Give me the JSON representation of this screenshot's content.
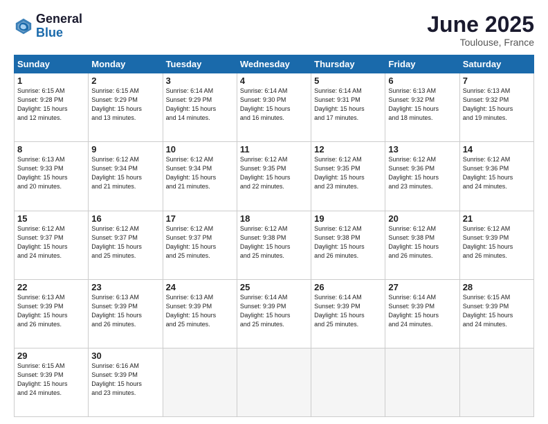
{
  "header": {
    "logo_line1": "General",
    "logo_line2": "Blue",
    "month": "June 2025",
    "location": "Toulouse, France"
  },
  "weekdays": [
    "Sunday",
    "Monday",
    "Tuesday",
    "Wednesday",
    "Thursday",
    "Friday",
    "Saturday"
  ],
  "days": [
    {
      "num": "",
      "info": ""
    },
    {
      "num": "",
      "info": ""
    },
    {
      "num": "",
      "info": ""
    },
    {
      "num": "",
      "info": ""
    },
    {
      "num": "",
      "info": ""
    },
    {
      "num": "",
      "info": ""
    },
    {
      "num": "7",
      "info": "Sunrise: 6:13 AM\nSunset: 9:32 PM\nDaylight: 15 hours\nand 19 minutes."
    },
    {
      "num": "1",
      "info": "Sunrise: 6:15 AM\nSunset: 9:28 PM\nDaylight: 15 hours\nand 12 minutes."
    },
    {
      "num": "2",
      "info": "Sunrise: 6:15 AM\nSunset: 9:29 PM\nDaylight: 15 hours\nand 13 minutes."
    },
    {
      "num": "3",
      "info": "Sunrise: 6:14 AM\nSunset: 9:29 PM\nDaylight: 15 hours\nand 14 minutes."
    },
    {
      "num": "4",
      "info": "Sunrise: 6:14 AM\nSunset: 9:30 PM\nDaylight: 15 hours\nand 16 minutes."
    },
    {
      "num": "5",
      "info": "Sunrise: 6:14 AM\nSunset: 9:31 PM\nDaylight: 15 hours\nand 17 minutes."
    },
    {
      "num": "6",
      "info": "Sunrise: 6:13 AM\nSunset: 9:32 PM\nDaylight: 15 hours\nand 18 minutes."
    },
    {
      "num": "7",
      "info": "Sunrise: 6:13 AM\nSunset: 9:32 PM\nDaylight: 15 hours\nand 19 minutes."
    },
    {
      "num": "8",
      "info": "Sunrise: 6:13 AM\nSunset: 9:33 PM\nDaylight: 15 hours\nand 20 minutes."
    },
    {
      "num": "9",
      "info": "Sunrise: 6:12 AM\nSunset: 9:34 PM\nDaylight: 15 hours\nand 21 minutes."
    },
    {
      "num": "10",
      "info": "Sunrise: 6:12 AM\nSunset: 9:34 PM\nDaylight: 15 hours\nand 21 minutes."
    },
    {
      "num": "11",
      "info": "Sunrise: 6:12 AM\nSunset: 9:35 PM\nDaylight: 15 hours\nand 22 minutes."
    },
    {
      "num": "12",
      "info": "Sunrise: 6:12 AM\nSunset: 9:35 PM\nDaylight: 15 hours\nand 23 minutes."
    },
    {
      "num": "13",
      "info": "Sunrise: 6:12 AM\nSunset: 9:36 PM\nDaylight: 15 hours\nand 23 minutes."
    },
    {
      "num": "14",
      "info": "Sunrise: 6:12 AM\nSunset: 9:36 PM\nDaylight: 15 hours\nand 24 minutes."
    },
    {
      "num": "15",
      "info": "Sunrise: 6:12 AM\nSunset: 9:37 PM\nDaylight: 15 hours\nand 24 minutes."
    },
    {
      "num": "16",
      "info": "Sunrise: 6:12 AM\nSunset: 9:37 PM\nDaylight: 15 hours\nand 25 minutes."
    },
    {
      "num": "17",
      "info": "Sunrise: 6:12 AM\nSunset: 9:37 PM\nDaylight: 15 hours\nand 25 minutes."
    },
    {
      "num": "18",
      "info": "Sunrise: 6:12 AM\nSunset: 9:38 PM\nDaylight: 15 hours\nand 25 minutes."
    },
    {
      "num": "19",
      "info": "Sunrise: 6:12 AM\nSunset: 9:38 PM\nDaylight: 15 hours\nand 26 minutes."
    },
    {
      "num": "20",
      "info": "Sunrise: 6:12 AM\nSunset: 9:38 PM\nDaylight: 15 hours\nand 26 minutes."
    },
    {
      "num": "21",
      "info": "Sunrise: 6:12 AM\nSunset: 9:39 PM\nDaylight: 15 hours\nand 26 minutes."
    },
    {
      "num": "22",
      "info": "Sunrise: 6:13 AM\nSunset: 9:39 PM\nDaylight: 15 hours\nand 26 minutes."
    },
    {
      "num": "23",
      "info": "Sunrise: 6:13 AM\nSunset: 9:39 PM\nDaylight: 15 hours\nand 26 minutes."
    },
    {
      "num": "24",
      "info": "Sunrise: 6:13 AM\nSunset: 9:39 PM\nDaylight: 15 hours\nand 25 minutes."
    },
    {
      "num": "25",
      "info": "Sunrise: 6:14 AM\nSunset: 9:39 PM\nDaylight: 15 hours\nand 25 minutes."
    },
    {
      "num": "26",
      "info": "Sunrise: 6:14 AM\nSunset: 9:39 PM\nDaylight: 15 hours\nand 25 minutes."
    },
    {
      "num": "27",
      "info": "Sunrise: 6:14 AM\nSunset: 9:39 PM\nDaylight: 15 hours\nand 24 minutes."
    },
    {
      "num": "28",
      "info": "Sunrise: 6:15 AM\nSunset: 9:39 PM\nDaylight: 15 hours\nand 24 minutes."
    },
    {
      "num": "29",
      "info": "Sunrise: 6:15 AM\nSunset: 9:39 PM\nDaylight: 15 hours\nand 24 minutes."
    },
    {
      "num": "30",
      "info": "Sunrise: 6:16 AM\nSunset: 9:39 PM\nDaylight: 15 hours\nand 23 minutes."
    },
    {
      "num": "",
      "info": ""
    },
    {
      "num": "",
      "info": ""
    },
    {
      "num": "",
      "info": ""
    },
    {
      "num": "",
      "info": ""
    },
    {
      "num": "",
      "info": ""
    }
  ]
}
